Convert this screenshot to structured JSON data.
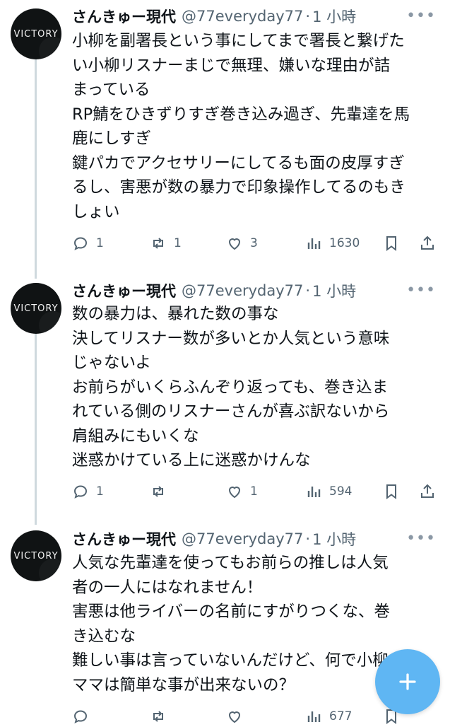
{
  "tweets": [
    {
      "avatar_text": "VICTORY",
      "name": "さんきゅー現代",
      "handle": "@77everyday77",
      "separator": "·",
      "time": "1 小時",
      "lines": [
        "小柳を副署長という事にしてまで署長と繋げた",
        "い小柳リスナーまじで無理、嫌いな理由が詰",
        "まっている",
        "RP鯖をひきずりすぎ巻き込み過ぎ、先輩達を馬",
        "鹿にしすぎ",
        "鍵パカでアクセサリーにしてるも面の皮厚すぎ",
        "るし、害悪が数の暴力で印象操作してるのもき",
        "しょい"
      ],
      "replies": "1",
      "retweets": "1",
      "likes": "3",
      "views": "1630"
    },
    {
      "avatar_text": "VICTORY",
      "name": "さんきゅー現代",
      "handle": "@77everyday77",
      "separator": "·",
      "time": "1 小時",
      "lines": [
        "数の暴力は、暴れた数の事な",
        "決してリスナー数が多いとか人気という意味",
        "じゃないよ",
        "お前らがいくらふんぞり返っても、巻き込ま",
        "れている側のリスナーさんが喜ぶ訳ないから",
        "肩組みにもいくな",
        "迷惑かけている上に迷惑かけんな"
      ],
      "replies": "1",
      "retweets": "",
      "likes": "1",
      "views": "594"
    },
    {
      "avatar_text": "VICTORY",
      "name": "さんきゅー現代",
      "handle": "@77everyday77",
      "separator": "·",
      "time": "1 小時",
      "lines": [
        "人気な先輩達を使ってもお前らの推しは人気",
        "者の一人にはなれません！",
        "害悪は他ライバーの名前にすがりつくな、巻",
        "き込むな",
        "難しい事は言っていないんだけど、何で小柳",
        "ママは簡単な事が出来ないの？"
      ],
      "replies": "",
      "retweets": "",
      "likes": "",
      "views": "677"
    }
  ],
  "icons": {
    "more": "more-icon",
    "reply": "reply-icon",
    "retweet": "retweet-icon",
    "like": "heart-icon",
    "views": "views-icon",
    "bookmark": "bookmark-icon",
    "share": "share-icon",
    "compose": "plus-icon"
  },
  "colors": {
    "text": "#0f1419",
    "secondary": "#536471",
    "thread_line": "#cfd9de",
    "fab": "#5fb6f3"
  }
}
